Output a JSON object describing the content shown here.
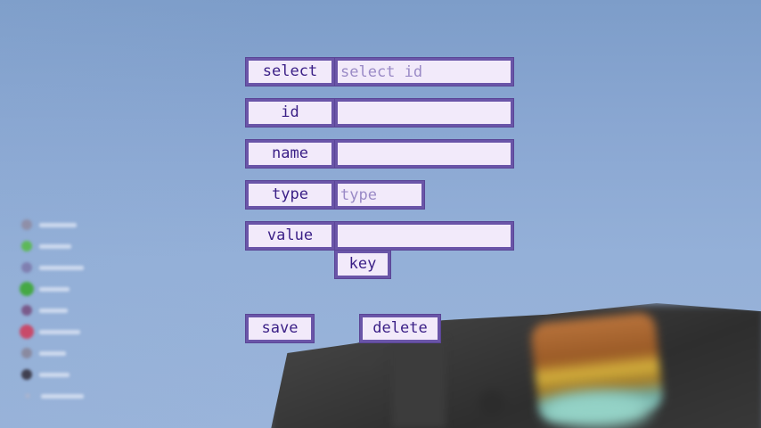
{
  "form": {
    "select": {
      "label": "select",
      "placeholder": "select id",
      "value": ""
    },
    "id": {
      "label": "id",
      "placeholder": "",
      "value": ""
    },
    "name": {
      "label": "name",
      "placeholder": "",
      "value": ""
    },
    "type": {
      "label": "type",
      "placeholder": "type",
      "value": ""
    },
    "value": {
      "label": "value",
      "placeholder": "",
      "value": ""
    },
    "key_button": "key"
  },
  "actions": {
    "save_label": "save",
    "delete_label": "delete"
  },
  "colors": {
    "border": "#6a55a8",
    "fill": "#f2eafa",
    "text": "#3a1f86",
    "placeholder": "#9a8ac6",
    "sky": "#8aa7d2"
  },
  "hud": {
    "status_icons": [
      {
        "icon": "status-effect-icon",
        "color": "#8f8fa8"
      },
      {
        "icon": "status-effect-icon",
        "color": "#5db858"
      },
      {
        "icon": "status-effect-icon",
        "color": "#7f7fb0"
      },
      {
        "icon": "status-effect-icon",
        "color": "#45a845"
      },
      {
        "icon": "status-effect-icon",
        "color": "#7a5a8a"
      },
      {
        "icon": "status-effect-icon",
        "color": "#c84a6a"
      },
      {
        "icon": "status-effect-icon",
        "color": "#8a8aa0"
      },
      {
        "icon": "status-effect-icon",
        "color": "#404050"
      },
      {
        "icon": "status-effect-icon",
        "color": "#a8b4d0"
      }
    ]
  }
}
